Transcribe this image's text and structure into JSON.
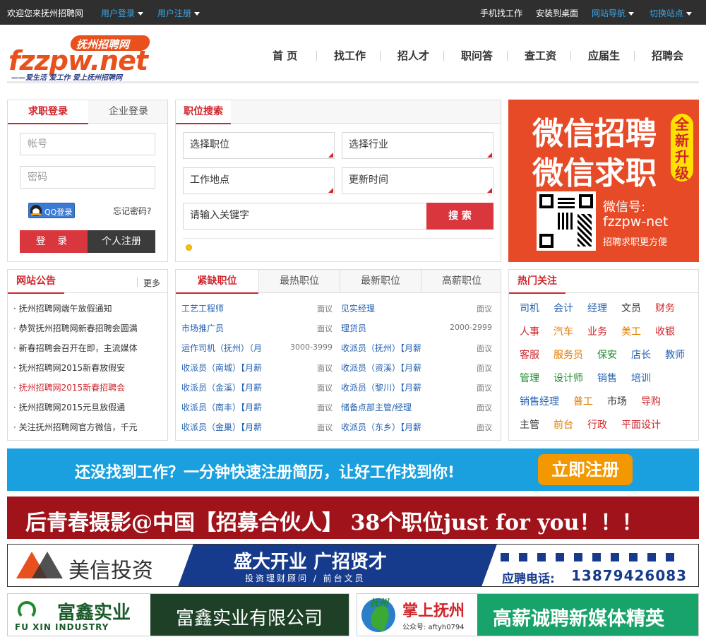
{
  "topbar": {
    "welcome": "欢迎您来抚州招聘网",
    "login": "用户登录",
    "register": "用户注册",
    "mobile": "手机找工作",
    "install": "安装到桌面",
    "site_nav": "网站导航",
    "switch_site": "切换站点"
  },
  "logo": {
    "badge": "抚州招聘网",
    "domain": "fzzpw.net",
    "slogan": "——爱生活 爱工作 爱上抚州招聘网"
  },
  "nav": [
    "首 页",
    "找工作",
    "招人才",
    "职问答",
    "查工资",
    "应届生",
    "招聘会"
  ],
  "login": {
    "tab_personal": "求职登录",
    "tab_company": "企业登录",
    "account_placeholder": "帐号",
    "password_placeholder": "密码",
    "qq": "QQ登录",
    "forgot": "忘记密码?",
    "login_btn": "登 录",
    "register_btn": "个人注册"
  },
  "search": {
    "title": "职位搜索",
    "job": "选择职位",
    "industry": "选择行业",
    "location": "工作地点",
    "update": "更新时间",
    "keyword_placeholder": "请输入关键字",
    "search_btn": "搜 索"
  },
  "wechat_ad": {
    "line1": "微信招聘",
    "line2": "微信求职",
    "badge": "全新升级",
    "id_label": "微信号:",
    "id": "fzzpw-net",
    "sub": "招聘求职更方便"
  },
  "notice": {
    "title": "网站公告",
    "more": "更多",
    "items": [
      "抚州招聘网端午放假通知",
      "恭贺抚州招聘网新春招聘会圆满",
      "新春招聘会召开在即，主流媒体",
      "抚州招聘网2015新春放假安",
      "抚州招聘网2015新春招聘会",
      "抚州招聘网2015元旦放假通",
      "关注抚州招聘网官方微信，千元"
    ],
    "highlight_index": 4
  },
  "jobs": {
    "tabs": [
      "紧缺职位",
      "最热职位",
      "最新职位",
      "高薪职位"
    ],
    "left": [
      {
        "title": "工艺工程师",
        "salary": "面议"
      },
      {
        "title": "市场推广员",
        "salary": "面议"
      },
      {
        "title": "运作司机（抚州）（月",
        "salary": "3000-3999"
      },
      {
        "title": "收派员（南城）【月薪",
        "salary": "面议"
      },
      {
        "title": "收派员（金溪）【月薪",
        "salary": "面议"
      },
      {
        "title": "收派员（南丰）【月薪",
        "salary": "面议"
      },
      {
        "title": "收派员（金巢）【月薪",
        "salary": "面议"
      }
    ],
    "right": [
      {
        "title": "见实经理",
        "salary": "面议"
      },
      {
        "title": "理货员",
        "salary": "2000-2999"
      },
      {
        "title": "收派员（抚州）【月薪",
        "salary": "面议"
      },
      {
        "title": "收派员（资溪）【月薪",
        "salary": "面议"
      },
      {
        "title": "收派员（黎川）【月薪",
        "salary": "面议"
      },
      {
        "title": "储备点部主管/经理",
        "salary": "面议"
      },
      {
        "title": "收派员（东乡）【月薪",
        "salary": "面议"
      }
    ]
  },
  "hot": {
    "title": "热门关注",
    "rows": [
      [
        {
          "t": "司机",
          "c": "#2662b0"
        },
        {
          "t": "会计",
          "c": "#2662b0"
        },
        {
          "t": "经理",
          "c": "#2662b0"
        },
        {
          "t": "文员",
          "c": "#333333"
        },
        {
          "t": "财务",
          "c": "#d0252c"
        }
      ],
      [
        {
          "t": "人事",
          "c": "#d0252c"
        },
        {
          "t": "汽车",
          "c": "#e07b00"
        },
        {
          "t": "业务",
          "c": "#d0252c"
        },
        {
          "t": "美工",
          "c": "#e07b00"
        },
        {
          "t": "收银",
          "c": "#d0252c"
        }
      ],
      [
        {
          "t": "客服",
          "c": "#d0252c"
        },
        {
          "t": "服务员",
          "c": "#e07b00"
        },
        {
          "t": "保安",
          "c": "#1f8a2e"
        },
        {
          "t": "店长",
          "c": "#2662b0"
        },
        {
          "t": "教师",
          "c": "#2662b0"
        }
      ],
      [
        {
          "t": "管理",
          "c": "#1f8a2e"
        },
        {
          "t": "设计师",
          "c": "#1f8a2e"
        },
        {
          "t": "销售",
          "c": "#2662b0"
        },
        {
          "t": "培训",
          "c": "#2662b0"
        }
      ],
      [
        {
          "t": "销售经理",
          "c": "#2662b0"
        },
        {
          "t": "普工",
          "c": "#e07b00"
        },
        {
          "t": "市场",
          "c": "#333333"
        },
        {
          "t": "导购",
          "c": "#d0252c"
        }
      ],
      [
        {
          "t": "主管",
          "c": "#333333"
        },
        {
          "t": "前台",
          "c": "#e07b00"
        },
        {
          "t": "行政",
          "c": "#d0252c"
        },
        {
          "t": "平面设计",
          "c": "#d0252c"
        }
      ]
    ]
  },
  "banners": {
    "register_text": "还没找到工作？一分钟快速注册简历，让好工作找到你!",
    "register_btn": "立即注册",
    "photo_text": "后青春摄影@中国【招募合伙人】  38个职位just for you！！！",
    "meixin_name": "美信投资",
    "meixin_slogan": "盛大开业  广招贤才",
    "meixin_sub": "投资理财顾问 / 前台文员",
    "meixin_phone_label": "应聘电话:",
    "meixin_phone": "13879426083",
    "fuxin_cn": "富鑫实业",
    "fuxin_en": "FU XIN INDUSTRY",
    "fuxin_full": "富鑫实业有限公司",
    "zsfz_name": "掌上抚州",
    "zsfz_account": "公众号: aftyh0794",
    "zsfz_slogan": "高薪诚聘新媒体精英",
    "zsfz_mark": "抚州"
  },
  "colors": {
    "accent": "#d0252c",
    "link": "#2662b0",
    "topbar": "#2f2f2f",
    "banner_blue": "#1aa0de",
    "banner_orange": "#f39800"
  }
}
